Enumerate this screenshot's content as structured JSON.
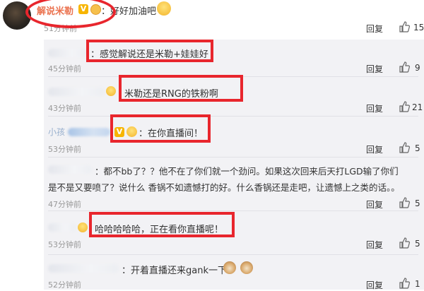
{
  "top_comment": {
    "author": "解说米勒",
    "badge": "V",
    "text": "：好好加油吧",
    "time": "51分钟前",
    "reply": "回复",
    "likes": "15"
  },
  "replies": [
    {
      "text": "：感觉解说还是米勒+娃娃好",
      "time": "45分钟前",
      "reply": "回复",
      "likes": "9"
    },
    {
      "text": "米勒还是RNG的铁粉啊",
      "time": "43分钟前",
      "reply": "回复",
      "likes": "21"
    },
    {
      "name": "小孩",
      "text": "：在你直播间！",
      "time": "53分钟前",
      "reply": "回复",
      "likes": "5"
    },
    {
      "text_line1": "：都不bb了？？他不在了你们就一个劲问。如果这次回来后天打LGD输了你们",
      "text_line2": "是不是又要喷了？说什么 香锅不如遗憾打的好。什么香锅还是走吧，让遗憾上之类的话。。",
      "time": "47分钟前",
      "reply": "回复",
      "likes": "5"
    },
    {
      "text": "哈哈哈哈哈，正在看你直播呢！",
      "time": "53分钟前",
      "reply": "回复",
      "likes": "5"
    },
    {
      "text": "：开着直播还来gank一下",
      "time": "52分钟前",
      "reply": "回复",
      "likes": "1"
    }
  ],
  "colors": {
    "highlight": "#e8262d",
    "author_orange": "#eb7350",
    "name_blue": "#3e6ea7",
    "panel_bg": "#f2f2f5"
  }
}
